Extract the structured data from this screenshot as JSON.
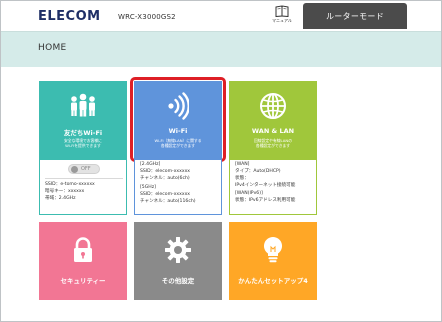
{
  "header": {
    "logo": "ELECOM",
    "model": "WRC-X3000GS2",
    "manual_label": "マニュアル",
    "mode_tab_label": "ルーターモード"
  },
  "page": {
    "title": "HOME"
  },
  "tiles": {
    "friend_wifi": {
      "label": "友だちWi-Fi",
      "desc1": "安全な環境でお客様に",
      "desc2": "Wi-Fiを提供できます",
      "toggle_label": "OFF",
      "info": [
        "SSID：e-tomo-xxxxxx",
        "暗号キー：xxxxxx",
        "帯域：2.4GHz"
      ]
    },
    "wifi": {
      "label": "Wi-Fi",
      "desc1": "Wi-Fi（無線LAN）に関する",
      "desc2": "各種設定ができます",
      "info": [
        "[2.4GHz]",
        "SSID：elecom-xxxxxx",
        "チャンネル：auto(6ch)",
        "[5GHz]",
        "SSID：elecom-xxxxxx",
        "チャンネル：auto(116ch)"
      ]
    },
    "wan_lan": {
      "label": "WAN & LAN",
      "desc1": "回線設定や有線LANの",
      "desc2": "各種設定ができます",
      "info": [
        "[WAN]",
        "タイプ：Auto(DHCP)",
        "状態：",
        "IPv4インターネット接続可能",
        "[WAN(IPv6)]",
        "状態：IPv6アドレス利用可能"
      ]
    },
    "security": {
      "label": "セキュリティー"
    },
    "other": {
      "label": "その他設定"
    },
    "setup": {
      "label": "かんたんセットアップ4"
    }
  },
  "colors": {
    "friend": "#3cbcb0",
    "wifi": "#5f94db",
    "wan": "#a0c73b",
    "security": "#f27694",
    "other": "#8a8a8a",
    "setup": "#ffa726",
    "highlight": "#de1f26",
    "title_band": "#d5ebe9",
    "mode_tab": "#4b4b4b"
  },
  "icons": {
    "manual": "book-icon",
    "friend": "people-group-icon",
    "wifi": "wifi-signal-icon",
    "wan": "globe-icon",
    "security": "padlock-icon",
    "other": "gear-icon",
    "setup": "lightbulb-icon"
  }
}
